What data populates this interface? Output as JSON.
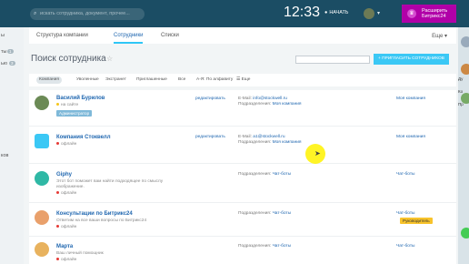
{
  "topbar": {
    "search_placeholder": "искать сотрудника, документ, прочее...",
    "time": "12:33",
    "start_label": "НАЧАТЬ",
    "promo": [
      "Расширить",
      "Битрикс24"
    ]
  },
  "leftnav": {
    "items": [
      "ы",
      "ты",
      "ью",
      "ков"
    ],
    "badges": [
      "1",
      "3"
    ]
  },
  "rightpanel": {
    "labels": [
      "Ду",
      "Ко",
      "Пр"
    ]
  },
  "tabs": [
    "Структура компании",
    "Сотрудники",
    "Списки"
  ],
  "more_label": "Еще",
  "page_title": "Поиск сотрудника",
  "invite_label": "+ ПРИГЛАСИТЬ СОТРУДНИКОВ",
  "presets": [
    "Компания",
    "Уволенные",
    "Экстранет",
    "Приглашенные",
    "Все",
    "А-Я: По алфавиту",
    "Еще"
  ],
  "employees": [
    {
      "name": "Василий Бурилов",
      "status": "на сайте",
      "status_color": "#f5c518",
      "badge": "Администратор",
      "edit": "редактировать",
      "email_label": "E-Mail:",
      "email": "info@stockwell.ru",
      "dept_label": "Подразделения:",
      "dept": "Моя компания",
      "dept_right": "Моя компания"
    },
    {
      "name": "Компания Стоквелл",
      "status": "офлайн",
      "status_color": "#e53935",
      "edit": "редактировать",
      "email_label": "E-Mail:",
      "email": "a1@stockwell.ru",
      "dept_label": "Подразделения:",
      "dept": "Моя компания",
      "dept_right": "Моя компания"
    },
    {
      "name": "Giphy",
      "info": [
        "Этот бот поможет вам найти подходящее по смыслу",
        "изображение."
      ],
      "status": "офлайн",
      "status_color": "#e53935",
      "dept_label": "Подразделения:",
      "dept": "Чат-боты",
      "dept_right": "Чат-боты"
    },
    {
      "name": "Консультации по Битрикс24",
      "info": [
        "Ответим на все ваши вопросы по Битрикс24"
      ],
      "status": "офлайн",
      "status_color": "#e53935",
      "dept_label": "Подразделения:",
      "dept": "Чат-боты",
      "dept_right": "Чат-боты",
      "head_badge": "Руководитель"
    },
    {
      "name": "Марта",
      "info": [
        "Ваш личный помощник"
      ],
      "status": "офлайн",
      "status_color": "#e53935",
      "dept_label": "Подразделения:",
      "dept": "Чат-боты",
      "dept_right": "Чат-боты"
    }
  ],
  "colors": {
    "topbar": "#1b4d64",
    "accent": "#3bc8f5",
    "promo": "#b100a8",
    "link": "#2067b0"
  }
}
